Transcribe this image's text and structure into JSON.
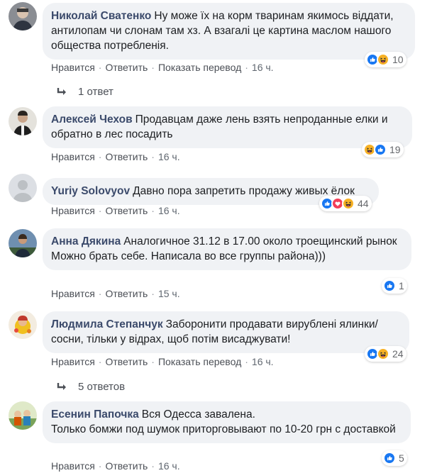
{
  "actions": {
    "like": "Нравится",
    "reply": "Ответить",
    "translate": "Показать перевод",
    "sep": "·"
  },
  "comments": [
    {
      "author": "Николай Сватенко",
      "text": "Ну може їх на корм тваринам якимось віддати, антилопам чи слонам там хз. А взагалі це картина маслом нашого общества потребленія.",
      "time": "16 ч.",
      "reaction_count": "10",
      "reactions": [
        "like-icon",
        "haha-icon"
      ],
      "replies": "1 ответ"
    },
    {
      "author": "Алексей Чехов",
      "text": "Продавцам даже лень взять непроданные елки и обратно в лес посадить",
      "time": "16 ч.",
      "reaction_count": "19",
      "reactions": [
        "haha-icon",
        "like-icon"
      ]
    },
    {
      "author": "Yuriy Solovyov",
      "text": "Давно пора запретить продажу живых ёлок",
      "time": "16 ч.",
      "reaction_count": "44",
      "reactions": [
        "like-icon",
        "love-icon",
        "haha-icon"
      ]
    },
    {
      "author": "Анна Дякина",
      "text": "Аналогичное 31.12 в 17.00 около троещинский рынок\nМожно брать себе. Написала во все группы района)))",
      "time": "15 ч.",
      "reaction_count": "1",
      "reactions": [
        "like-icon"
      ]
    },
    {
      "author": "Людмила Степанчук",
      "text": "Заборонити продавати вирублені ялинки/ сосни, тільки у відрах, щоб потім висаджувати!",
      "time": "16 ч.",
      "reaction_count": "24",
      "reactions": [
        "like-icon",
        "haha-icon"
      ],
      "replies": "5 ответов"
    },
    {
      "author": "Есенин Папочка",
      "text": "Вся Одесса завалена.\nТолько бомжи под шумок приторговывают по 10-20 грн с доставкой",
      "time": "16 ч.",
      "reaction_count": "5",
      "reactions": [
        "like-icon"
      ]
    }
  ],
  "colors": {
    "like": "#1877f2",
    "love": "#f33e58",
    "haha": "#f7b125",
    "author": "#3b4a6b",
    "bubble": "#f0f2f5"
  }
}
